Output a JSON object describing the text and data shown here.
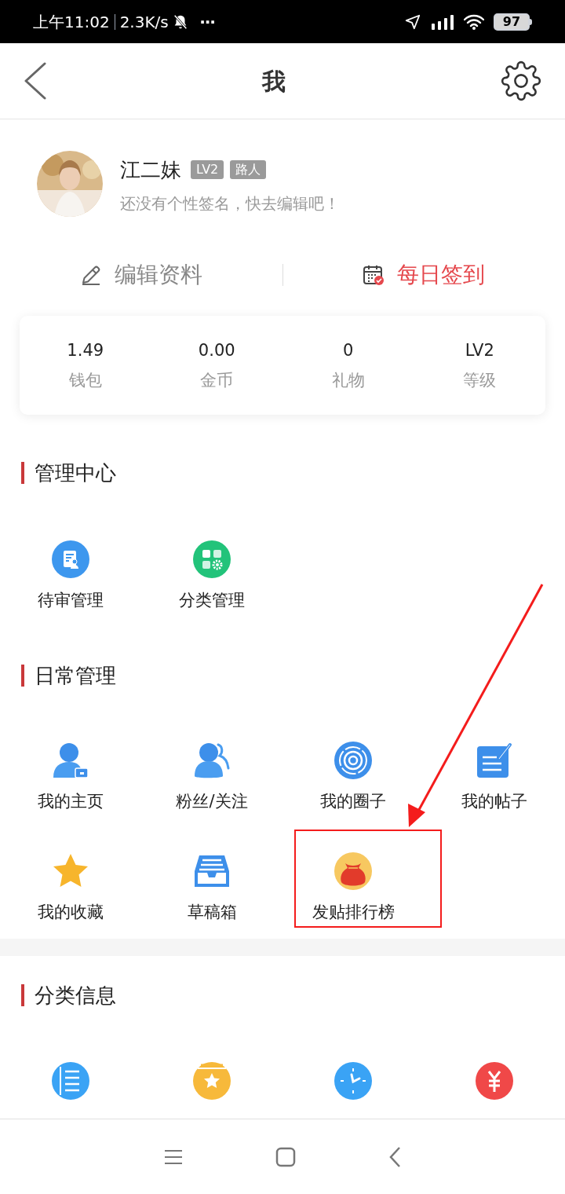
{
  "status_bar": {
    "time": "上午11:02",
    "speed": "2.3K/s",
    "more": "⋯",
    "battery": "97"
  },
  "header": {
    "title": "我"
  },
  "profile": {
    "name": "江二妹",
    "badges": [
      "LV2",
      "路人"
    ],
    "signature": "还没有个性签名，快去编辑吧！"
  },
  "actions": [
    {
      "kind": "edit",
      "label": "编辑资料"
    },
    {
      "kind": "checkin",
      "label": "每日签到"
    }
  ],
  "stats": [
    {
      "value": "1.49",
      "label": "钱包"
    },
    {
      "value": "0.00",
      "label": "金币"
    },
    {
      "value": "0",
      "label": "礼物"
    },
    {
      "value": "LV2",
      "label": "等级"
    }
  ],
  "sections": [
    {
      "title": "管理中心",
      "items": [
        {
          "kind": "review",
          "label": "待审管理"
        },
        {
          "kind": "category",
          "label": "分类管理"
        }
      ]
    },
    {
      "title": "日常管理",
      "items": [
        {
          "kind": "home",
          "label": "我的主页"
        },
        {
          "kind": "fans",
          "label": "粉丝/关注"
        },
        {
          "kind": "circle",
          "label": "我的圈子"
        },
        {
          "kind": "posts",
          "label": "我的帖子"
        },
        {
          "kind": "favorite",
          "label": "我的收藏"
        },
        {
          "kind": "drafts",
          "label": "草稿箱"
        },
        {
          "kind": "ranking",
          "label": "发贴排行榜"
        }
      ]
    },
    {
      "title": "分类信息",
      "items": [
        {
          "kind": "list"
        },
        {
          "kind": "collect"
        },
        {
          "kind": "clock"
        },
        {
          "kind": "yuan"
        }
      ]
    }
  ]
}
